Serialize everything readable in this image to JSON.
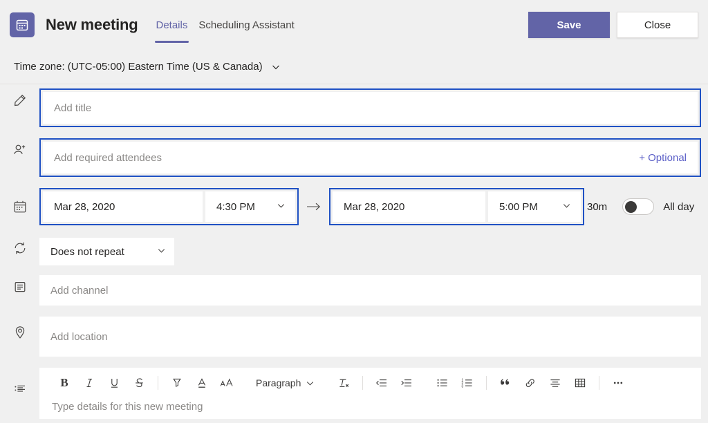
{
  "header": {
    "app_icon": "calendar-icon",
    "title": "New meeting",
    "tabs": [
      {
        "label": "Details",
        "active": true
      },
      {
        "label": "Scheduling Assistant",
        "active": false
      }
    ],
    "save_label": "Save",
    "close_label": "Close",
    "accent_color": "#6264a7"
  },
  "timezone": {
    "label": "Time zone: (UTC-05:00) Eastern Time (US & Canada)",
    "chevron": "chevron-down-icon"
  },
  "form": {
    "title_field": {
      "icon": "pencil-icon",
      "placeholder": "Add title",
      "value": "",
      "focused": true
    },
    "attendees_field": {
      "icon": "add-person-icon",
      "placeholder": "Add required attendees",
      "value": "",
      "optional_label": "+ Optional",
      "optional_color": "#5b5fc7",
      "focused": true
    },
    "datetime": {
      "icon": "calendar-icon",
      "start_date": "Mar 28, 2020",
      "start_time": "4:30 PM",
      "arrow": "arrow-right-icon",
      "end_date": "Mar 28, 2020",
      "end_time": "5:00 PM",
      "duration": "30m",
      "all_day_label": "All day",
      "all_day_on": false,
      "focused": true
    },
    "repeat": {
      "icon": "repeat-icon",
      "value": "Does not repeat"
    },
    "channel_field": {
      "icon": "channel-icon",
      "placeholder": "Add channel",
      "value": ""
    },
    "location_field": {
      "icon": "location-pin-icon",
      "placeholder": "Add location",
      "value": ""
    },
    "details_field": {
      "icon": "details-list-icon",
      "placeholder": "Type details for this new meeting",
      "value": ""
    }
  },
  "toolbar": {
    "items": [
      {
        "name": "bold-icon",
        "label": "B"
      },
      {
        "name": "italic-icon",
        "label": "I"
      },
      {
        "name": "underline-icon",
        "label": "U"
      },
      {
        "name": "strikethrough-icon",
        "label": "S"
      },
      {
        "name": "highlight-icon",
        "label": ""
      },
      {
        "name": "font-color-icon",
        "label": "A"
      },
      {
        "name": "font-size-icon",
        "label": "AA"
      },
      {
        "name": "paragraph-style-dropdown",
        "label": "Paragraph"
      },
      {
        "name": "clear-formatting-icon",
        "label": ""
      },
      {
        "name": "decrease-indent-icon",
        "label": ""
      },
      {
        "name": "increase-indent-icon",
        "label": ""
      },
      {
        "name": "bulleted-list-icon",
        "label": ""
      },
      {
        "name": "numbered-list-icon",
        "label": ""
      },
      {
        "name": "quote-icon",
        "label": ""
      },
      {
        "name": "link-icon",
        "label": ""
      },
      {
        "name": "align-icon",
        "label": ""
      },
      {
        "name": "table-icon",
        "label": ""
      },
      {
        "name": "more-options-icon",
        "label": ""
      }
    ],
    "paragraph_label": "Paragraph",
    "bold_label": "B",
    "italic_label": "I",
    "underline_label": "U",
    "strikethrough_label": "S",
    "font_color_label": "A",
    "font_size_label": "AA",
    "more_label": "•••"
  }
}
